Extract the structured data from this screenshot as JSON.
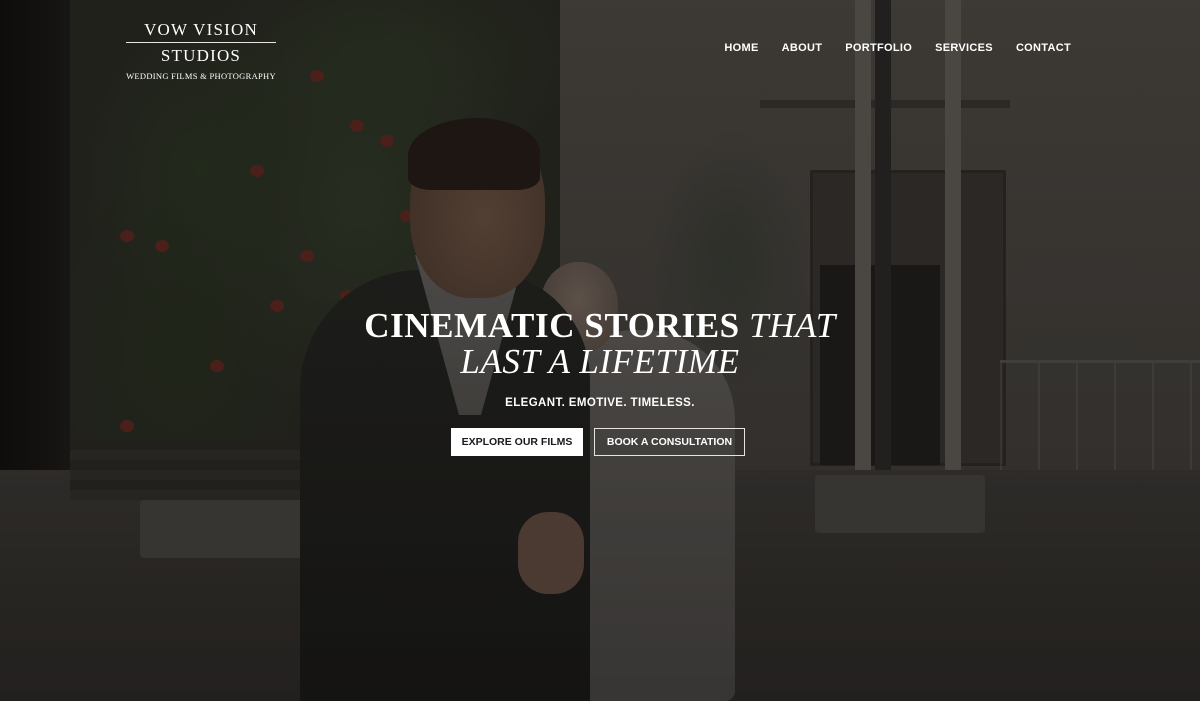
{
  "logo": {
    "line1": "VOW VISION",
    "line2": "STUDIOS",
    "tagline": "WEDDING FILMS & PHOTOGRAPHY"
  },
  "nav": {
    "items": [
      {
        "label": "HOME"
      },
      {
        "label": "ABOUT"
      },
      {
        "label": "PORTFOLIO"
      },
      {
        "label": "SERVICES"
      },
      {
        "label": "CONTACT"
      }
    ]
  },
  "hero": {
    "headline_bold": "CINEMATIC STORIES",
    "headline_italic_1": "THAT",
    "headline_italic_2": "LAST A LIFETIME",
    "subheading": "ELEGANT. EMOTIVE. TIMELESS.",
    "primary_cta": "EXPLORE OUR FILMS",
    "secondary_cta": "BOOK A CONSULTATION",
    "background": "wedding-couple-photo"
  },
  "colors": {
    "text": "#ffffff",
    "overlay": "#12110f",
    "button_primary_bg": "#ffffff",
    "button_primary_text": "#1a1a1a"
  }
}
